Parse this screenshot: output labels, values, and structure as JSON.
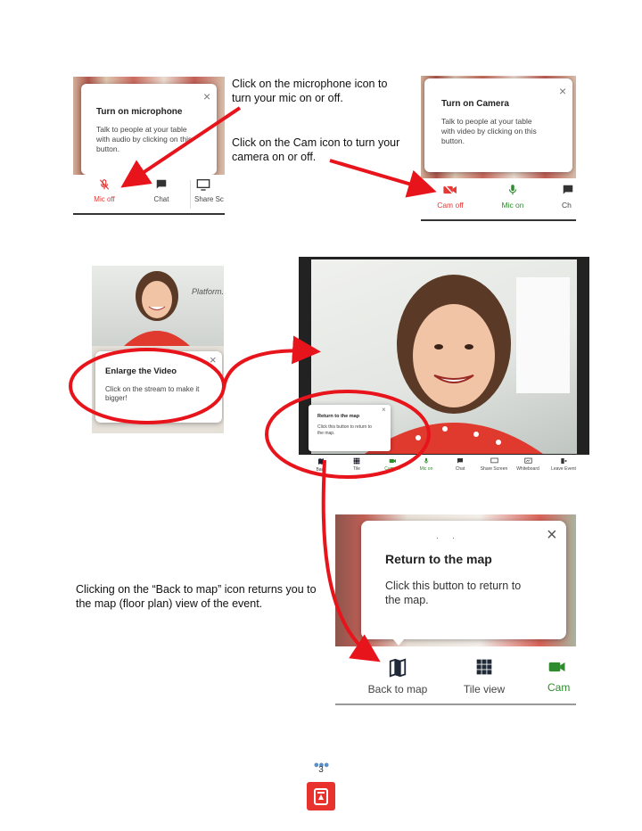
{
  "captions": {
    "mic": [
      "Click on the microphone icon to",
      "turn your mic on or off."
    ],
    "cam": [
      "Click on the Cam icon to turn your",
      "camera on or off."
    ],
    "map": [
      "Clicking on the “Back to map” icon returns you to",
      "the map (floor plan) view of the event."
    ]
  },
  "mic_panel": {
    "tip_title": "Turn on microphone",
    "tip_body": [
      "Talk to people at your table",
      "with audio by clicking on this",
      "button."
    ],
    "close": "×",
    "buttons": [
      "Mic off",
      "Chat",
      "Share Sc"
    ]
  },
  "cam_panel": {
    "tip_title": "Turn on Camera",
    "tip_body": [
      "Talk to people at your table",
      "with video by clicking on this",
      "button."
    ],
    "close": "×",
    "buttons": [
      "Cam off",
      "Mic on",
      "Ch"
    ]
  },
  "enlarge_panel": {
    "bg_text": "Platform.",
    "tip_title": "Enlarge the Video",
    "tip_body": [
      "Click on the stream to make it",
      "bigger!"
    ],
    "close": "×"
  },
  "video_panel": {
    "tip_title": "Return to the map",
    "tip_body": [
      "Click this button to return to",
      "the map."
    ],
    "close": "×",
    "buttons": [
      "Back",
      "Tile",
      "Cam on",
      "Mic on",
      "Chat",
      "Share Screen",
      "Whiteboard",
      "Leave Event"
    ]
  },
  "map_panel": {
    "tip_title": "Return to the map",
    "tip_body": [
      "Click this button to return to",
      "the map."
    ],
    "close": "×",
    "buttons": [
      "Back to map",
      "Tile view",
      "Cam"
    ]
  },
  "page_number": "3",
  "colors": {
    "arrow_red": "#e8141c",
    "mic_off_red": "#e53935",
    "on_green": "#2e8b2e",
    "logo_red": "#e8322d"
  }
}
